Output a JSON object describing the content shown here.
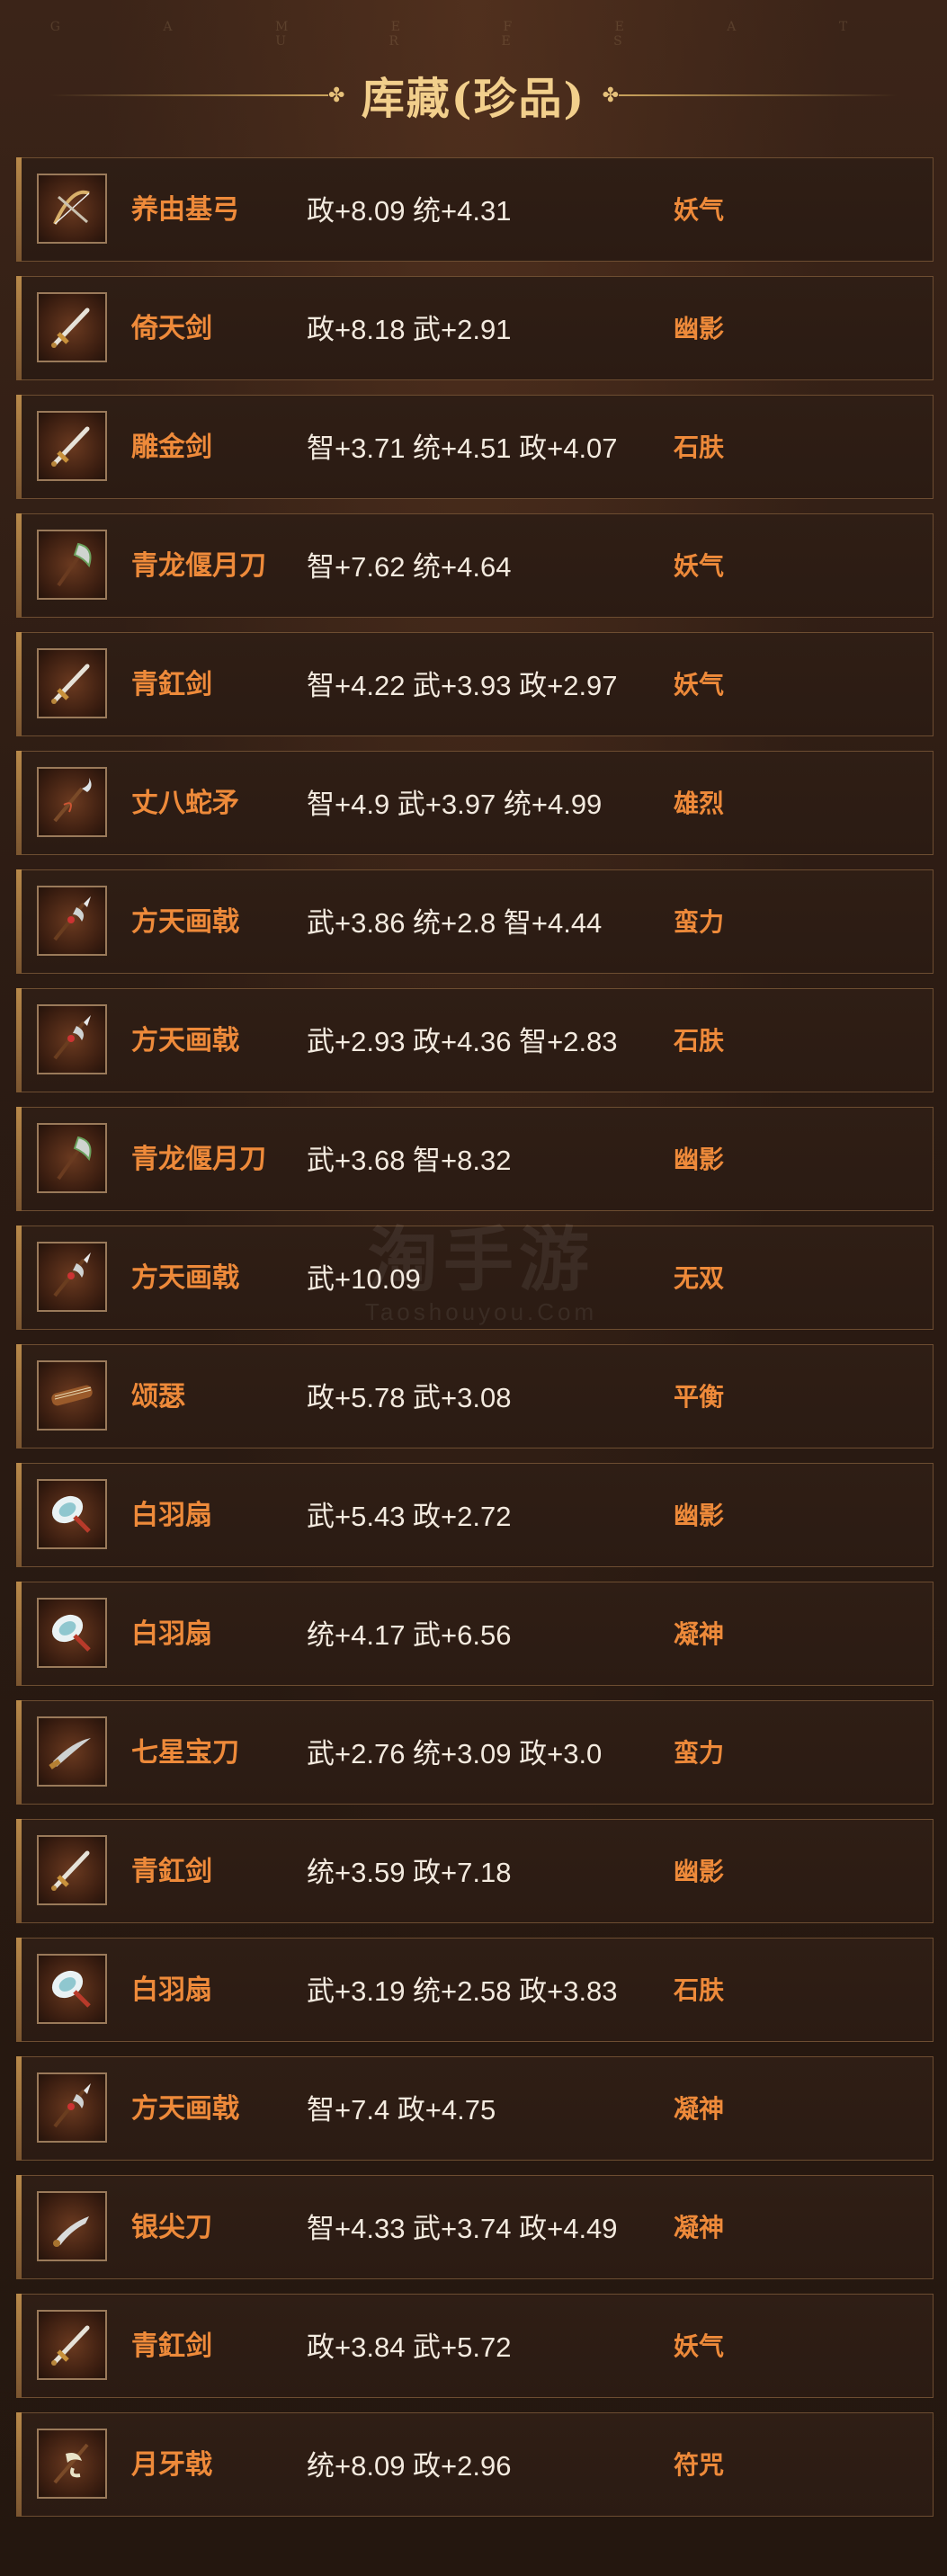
{
  "header": {
    "subtitle_letters": "G A M E F E A T U R E S",
    "title": "库藏(珍品)"
  },
  "watermark": {
    "brand": "淘手游",
    "site": "Taoshouyou.Com"
  },
  "items": [
    {
      "name": "养由基弓",
      "stats": "政+8.09 统+4.31",
      "trait": "妖气",
      "icon": "bow-icon"
    },
    {
      "name": "倚天剑",
      "stats": "政+8.18 武+2.91",
      "trait": "幽影",
      "icon": "sword-icon"
    },
    {
      "name": "雕金剑",
      "stats": "智+3.71 统+4.51 政+4.07",
      "trait": "石肤",
      "icon": "sword-icon"
    },
    {
      "name": "青龙偃月刀",
      "stats": "智+7.62 统+4.64",
      "trait": "妖气",
      "icon": "glaive-icon"
    },
    {
      "name": "青釭剑",
      "stats": "智+4.22 武+3.93 政+2.97",
      "trait": "妖气",
      "icon": "sword-icon"
    },
    {
      "name": "丈八蛇矛",
      "stats": "智+4.9 武+3.97 统+4.99",
      "trait": "雄烈",
      "icon": "serpent-spear-icon"
    },
    {
      "name": "方天画戟",
      "stats": "武+3.86 统+2.8 智+4.44",
      "trait": "蛮力",
      "icon": "halberd-icon"
    },
    {
      "name": "方天画戟",
      "stats": "武+2.93 政+4.36 智+2.83",
      "trait": "石肤",
      "icon": "halberd-icon"
    },
    {
      "name": "青龙偃月刀",
      "stats": "武+3.68 智+8.32",
      "trait": "幽影",
      "icon": "glaive-icon"
    },
    {
      "name": "方天画戟",
      "stats": "武+10.09",
      "trait": "无双",
      "icon": "halberd-icon"
    },
    {
      "name": "颂瑟",
      "stats": "政+5.78 武+3.08",
      "trait": "平衡",
      "icon": "zither-icon"
    },
    {
      "name": "白羽扇",
      "stats": "武+5.43 政+2.72",
      "trait": "幽影",
      "icon": "feather-fan-icon"
    },
    {
      "name": "白羽扇",
      "stats": "统+4.17 武+6.56",
      "trait": "凝神",
      "icon": "feather-fan-icon"
    },
    {
      "name": "七星宝刀",
      "stats": "武+2.76 统+3.09 政+3.0",
      "trait": "蛮力",
      "icon": "saber-icon"
    },
    {
      "name": "青釭剑",
      "stats": "统+3.59 政+7.18",
      "trait": "幽影",
      "icon": "sword-icon"
    },
    {
      "name": "白羽扇",
      "stats": "武+3.19 统+2.58 政+3.83",
      "trait": "石肤",
      "icon": "feather-fan-icon"
    },
    {
      "name": "方天画戟",
      "stats": "智+7.4 政+4.75",
      "trait": "凝神",
      "icon": "halberd-icon"
    },
    {
      "name": "银尖刀",
      "stats": "智+4.33 武+3.74 政+4.49",
      "trait": "凝神",
      "icon": "blade-icon"
    },
    {
      "name": "青釭剑",
      "stats": "政+3.84 武+5.72",
      "trait": "妖气",
      "icon": "sword-icon"
    },
    {
      "name": "月牙戟",
      "stats": "统+8.09 政+2.96",
      "trait": "符咒",
      "icon": "crescent-halberd-icon"
    }
  ]
}
